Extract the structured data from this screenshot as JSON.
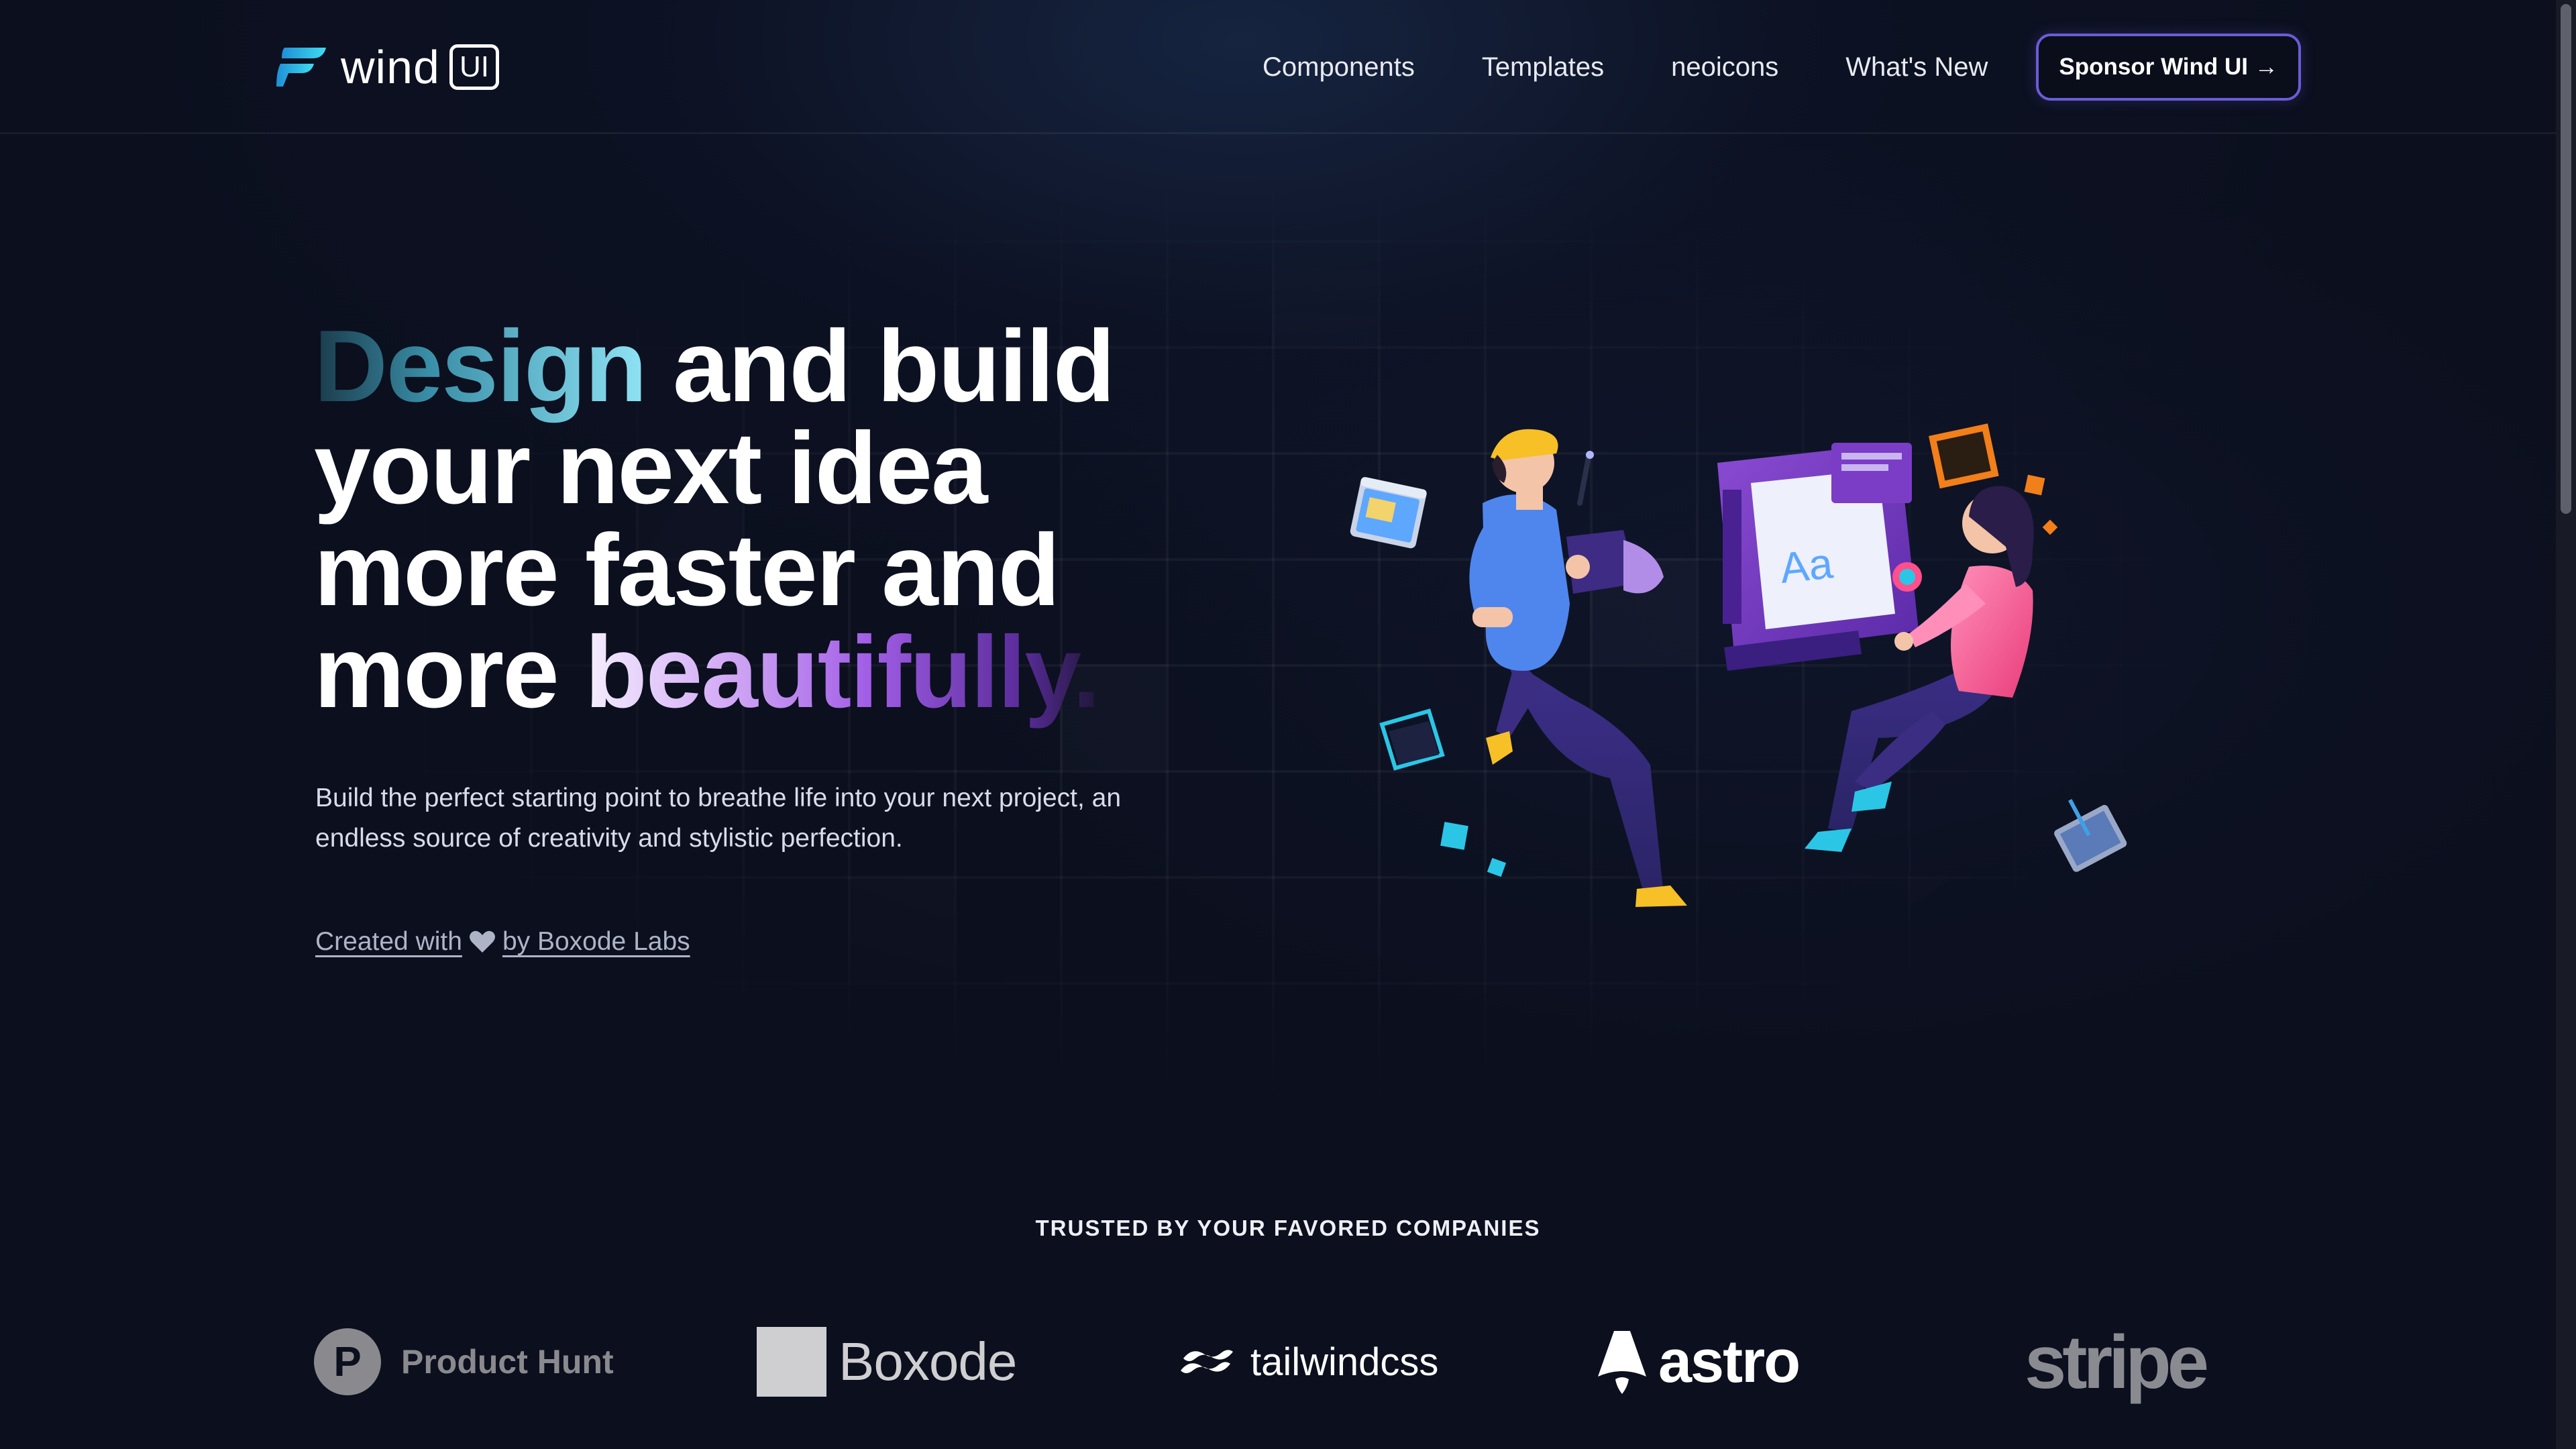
{
  "header": {
    "logo_text": "wind",
    "logo_badge": "UI",
    "nav": [
      {
        "label": "Components"
      },
      {
        "label": "Templates"
      },
      {
        "label": "neoicons"
      },
      {
        "label": "What's New"
      }
    ],
    "sponsor_label": "Sponsor Wind UI",
    "sponsor_arrow": "→"
  },
  "hero": {
    "title_highlight_1": "Design",
    "title_part_1": " and build your next idea more faster and more ",
    "title_highlight_2": "beautifully.",
    "subtitle": "Build the perfect starting point to breathe life into your next project, an endless source of creativity and stylistic perfection.",
    "credit_prefix": "Created with",
    "credit_suffix": "by Boxode Labs",
    "illustration_text": "Aa"
  },
  "trusted": {
    "heading": "TRUSTED BY YOUR FAVORED COMPANIES",
    "companies": [
      {
        "name": "Product Hunt",
        "mark": "P",
        "icon": "product-hunt-icon"
      },
      {
        "name": "Boxode",
        "icon": "boxode-square-icon"
      },
      {
        "name": "tailwindcss",
        "icon": "tailwind-wave-icon"
      },
      {
        "name": "astro",
        "icon": "astro-rocket-icon"
      },
      {
        "name": "stripe"
      }
    ]
  },
  "colors": {
    "background": "#0b0f1e",
    "accent_cyan": "#2bc6e6",
    "accent_purple": "#a15ee6",
    "sponsor_border": "#6a5cd8"
  }
}
